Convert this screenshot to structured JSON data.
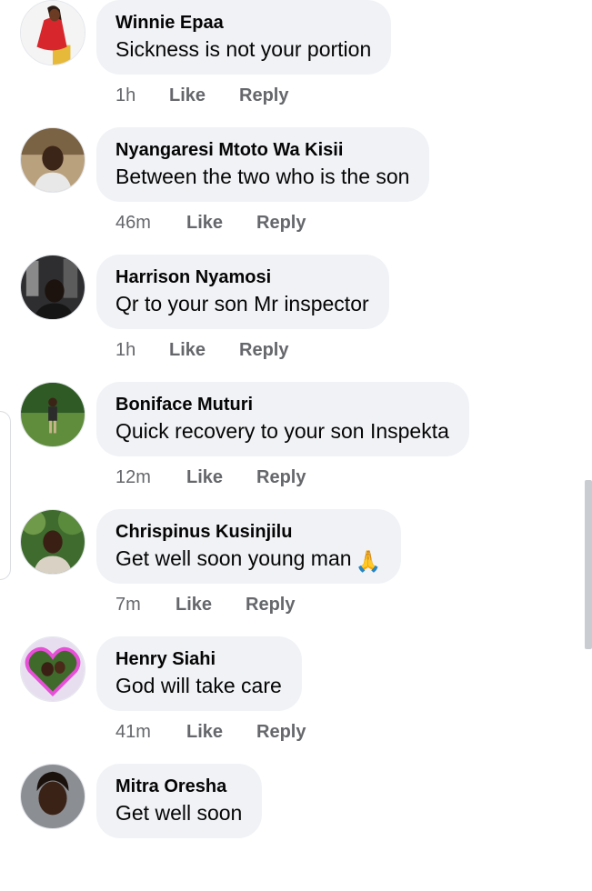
{
  "comments": [
    {
      "author": "Winnie Epaa",
      "text": "Sickness is not your portion",
      "time": "1h",
      "like": "Like",
      "reply": "Reply",
      "avatar_icon": "woman-red-dress-avatar"
    },
    {
      "author": "Nyangaresi Mtoto Wa Kisii",
      "text": "Between the two who is the son",
      "time": "46m",
      "like": "Like",
      "reply": "Reply",
      "avatar_icon": "man-portrait-avatar"
    },
    {
      "author": "Harrison Nyamosi",
      "text": "Qr to your son Mr inspector",
      "time": "1h",
      "like": "Like",
      "reply": "Reply",
      "avatar_icon": "man-portrait-avatar"
    },
    {
      "author": "Boniface Muturi",
      "text": "Quick recovery to your son Inspekta",
      "time": "12m",
      "like": "Like",
      "reply": "Reply",
      "avatar_icon": "man-on-grass-avatar"
    },
    {
      "author": "Chrispinus Kusinjilu",
      "text": "Get well soon young man",
      "emoji": "🙏",
      "time": "7m",
      "like": "Like",
      "reply": "Reply",
      "avatar_icon": "man-trees-avatar"
    },
    {
      "author": "Henry Siahi",
      "text": "God will take care",
      "time": "41m",
      "like": "Like",
      "reply": "Reply",
      "avatar_icon": "heart-frame-avatar"
    },
    {
      "author": "Mitra Oresha",
      "text": "Get well soon",
      "time": "",
      "like": "",
      "reply": "",
      "avatar_icon": "woman-portrait-avatar"
    }
  ],
  "colors": {
    "bubble": "#f0f2f5",
    "meta": "#65676b",
    "text": "#050505",
    "scrollbar": "#c9ccd1"
  }
}
